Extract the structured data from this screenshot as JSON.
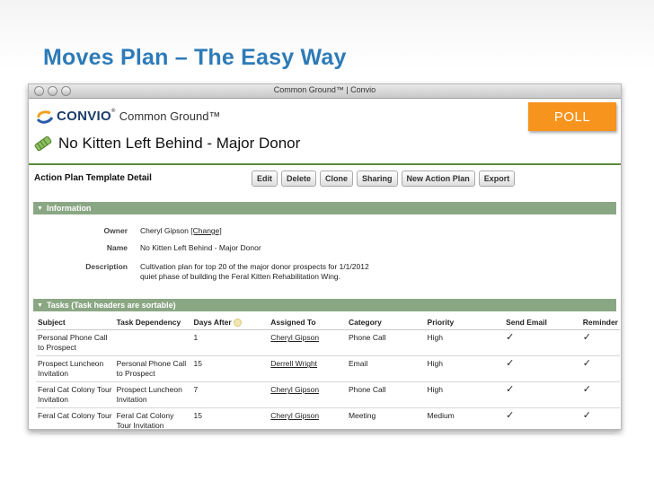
{
  "slide": {
    "title": "Moves Plan – The Easy Way"
  },
  "window": {
    "title": "Common Ground™ | Convio"
  },
  "app": {
    "brand": "CONVIO",
    "tm": "®",
    "product": "Common Ground™"
  },
  "poll": {
    "label": "POLL",
    "color": "#f7941d"
  },
  "plan": {
    "title": "No Kitten Left Behind - Major Donor",
    "icon": "ribbon-icon"
  },
  "detail": {
    "label": "Action Plan Template Detail",
    "buttons": [
      "Edit",
      "Delete",
      "Clone",
      "Sharing",
      "New Action Plan",
      "Export"
    ]
  },
  "information": {
    "header": "Information",
    "owner_label": "Owner",
    "owner_value": "Cheryl Gipson",
    "owner_change": "[Change]",
    "name_label": "Name",
    "name_value": "No Kitten Left Behind - Major Donor",
    "description_label": "Description",
    "description_value": "Cultivation plan for top 20 of the major donor prospects for 1/1/2012 quiet phase of building the Feral Kitten Rehabilitation Wing."
  },
  "tasks": {
    "header": "Tasks (Task headers are sortable)",
    "columns": [
      "Subject",
      "Task Dependency",
      "Days After",
      "Assigned To",
      "Category",
      "Priority",
      "Send Email",
      "Reminder"
    ],
    "check_glyph": "✓",
    "rows": [
      {
        "subject": "Personal Phone Call to Prospect",
        "dependency": "",
        "days": "1",
        "assigned": "Cheryl Gipson",
        "category": "Phone Call",
        "priority": "High"
      },
      {
        "subject": "Prospect Luncheon Invitation",
        "dependency": "Personal Phone Call to Prospect",
        "days": "15",
        "assigned": "Derrell Wright",
        "category": "Email",
        "priority": "High"
      },
      {
        "subject": "Feral Cat Colony Tour Invitation",
        "dependency": "Prospect Luncheon Invitation",
        "days": "7",
        "assigned": "Cheryl Gipson",
        "category": "Phone Call",
        "priority": "High"
      },
      {
        "subject": "Feral Cat Colony Tour",
        "dependency": "Feral Cat Colony Tour Invitation",
        "days": "15",
        "assigned": "Cheryl Gipson",
        "category": "Meeting",
        "priority": "Medium"
      }
    ]
  },
  "colors": {
    "title": "#2d7bb8",
    "section": "#8aa784",
    "rule": "#5c8a3c"
  }
}
